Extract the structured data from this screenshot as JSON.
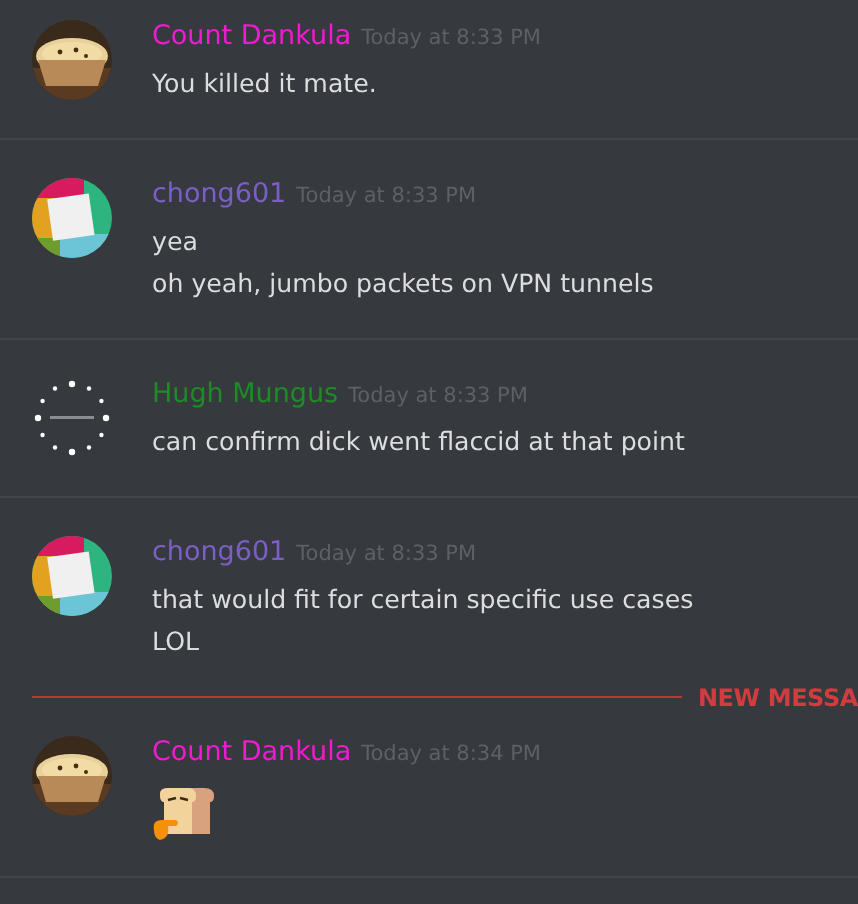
{
  "items": [
    {
      "kind": "message",
      "author": "Count Dankula",
      "color": "#f01bd0",
      "avatar": {
        "kind": "picture"
      },
      "timestamp": "Today at 8:33 PM",
      "content": [
        {
          "kind": "text",
          "text": "You killed it mate."
        }
      ]
    },
    {
      "kind": "message",
      "author": "chong601",
      "color": "#7c5fc6",
      "avatar": {
        "kind": "tiles"
      },
      "timestamp": "Today at 8:33 PM",
      "content": [
        {
          "kind": "text",
          "text": "yea"
        },
        {
          "kind": "text",
          "text": "oh yeah, jumbo packets on VPN tunnels"
        }
      ]
    },
    {
      "kind": "message",
      "author": "Hugh Mungus",
      "color": "#1f8b24",
      "avatar": {
        "kind": "loading"
      },
      "timestamp": "Today at 8:33 PM",
      "content": [
        {
          "kind": "text",
          "text": "can confirm dick went flaccid at that point"
        }
      ]
    },
    {
      "kind": "message",
      "author": "chong601",
      "color": "#7c5fc6",
      "avatar": {
        "kind": "tiles"
      },
      "timestamp": "Today at 8:33 PM",
      "content": [
        {
          "kind": "text",
          "text": "that would fit for certain specific use cases"
        },
        {
          "kind": "text",
          "text": "LOL"
        }
      ]
    },
    {
      "kind": "new_divider",
      "label": "NEW MESSA"
    },
    {
      "kind": "message",
      "author": "Count Dankula",
      "color": "#f01bd0",
      "avatar": {
        "kind": "picture"
      },
      "timestamp": "Today at 8:34 PM",
      "content": [
        {
          "kind": "emoji"
        }
      ]
    }
  ]
}
